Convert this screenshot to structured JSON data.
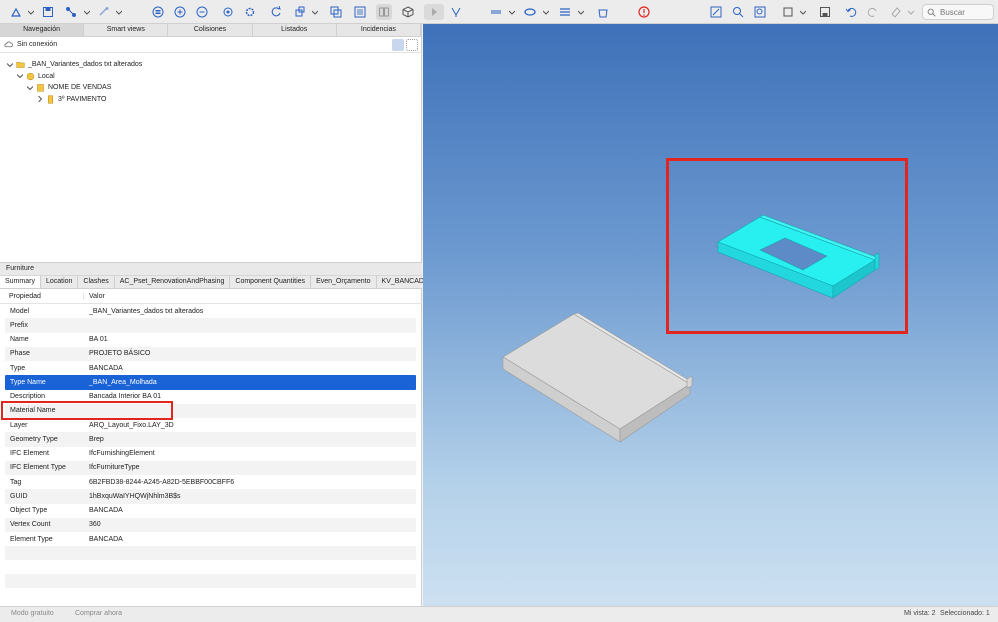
{
  "toolbar": {
    "search_placeholder": "Buscar"
  },
  "nav_tabs": [
    "Navegación",
    "Smart views",
    "Colisiones",
    "Listados",
    "Incidencias"
  ],
  "connection_status": "Sin conexión",
  "tree": {
    "root": "_BAN_Variantes_dados txt alterados",
    "site": "Local",
    "building": "NOME DE VENDAS",
    "storey": "3º PAVIMENTO"
  },
  "properties_section_title": "Furniture",
  "property_tabs": [
    "Summary",
    "Location",
    "Clashes",
    "AC_Pset_RenovationAndPhasing",
    "Component Quantities",
    "Even_Orçamento",
    "KV_BANCADAS"
  ],
  "property_headers": {
    "key": "Propiedad",
    "value": "Valor"
  },
  "properties": [
    {
      "key": "Model",
      "value": "_BAN_Variantes_dados txt alterados"
    },
    {
      "key": "Prefix",
      "value": ""
    },
    {
      "key": "Name",
      "value": "BA 01"
    },
    {
      "key": "Phase",
      "value": "PROJETO BÁSICO"
    },
    {
      "key": "Type",
      "value": "BANCADA"
    },
    {
      "key": "Type Name",
      "value": "_BAN_Area_Molhada"
    },
    {
      "key": "Description",
      "value": "Bancada Interior BA 01"
    },
    {
      "key": "Material Name",
      "value": ""
    },
    {
      "key": "Layer",
      "value": "ARQ_Layout_Fixo.LAY_3D"
    },
    {
      "key": "Geometry Type",
      "value": "Brep"
    },
    {
      "key": "IFC Element",
      "value": "IfcFurnishingElement"
    },
    {
      "key": "IFC Element Type",
      "value": "IfcFurnitureType"
    },
    {
      "key": "Tag",
      "value": "6B2FBD38-8244-A245-A82D-5EBBF00CBFF6"
    },
    {
      "key": "GUID",
      "value": "1hBxquWaIYHQWjNhlm3B$s"
    },
    {
      "key": "Object Type",
      "value": "BANCADA"
    },
    {
      "key": "Vertex Count",
      "value": "360"
    },
    {
      "key": "Element Type",
      "value": "BANCADA"
    }
  ],
  "selected_property": "Type Name",
  "status_bar": {
    "free_mode": "Modo gratuito",
    "buy_now": "Comprar ahora",
    "view": "Mi vista: 2",
    "selected": "Seleccionado: 1"
  },
  "colors": {
    "selection": "#1a63d6",
    "highlight_box": "#e0261e",
    "selected_object": "#25f0f0",
    "unselected_object": "#dcdcdc"
  }
}
